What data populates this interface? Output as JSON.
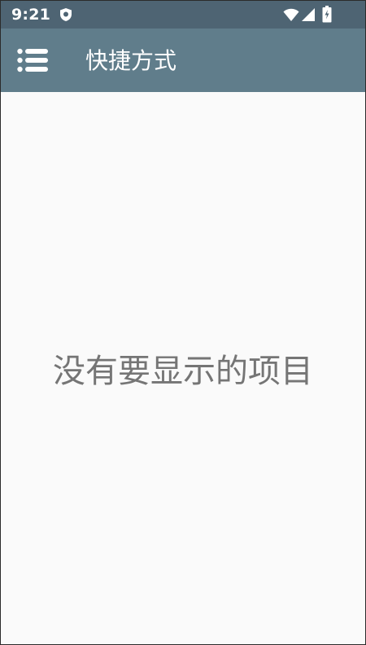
{
  "status_bar": {
    "time": "9:21",
    "icons": [
      "shield-icon",
      "wifi-icon",
      "signal-icon",
      "battery-icon"
    ]
  },
  "app_bar": {
    "title": "快捷方式",
    "menu_icon": "menu-icon",
    "background_color": "#607d8b"
  },
  "content": {
    "empty_message": "没有要显示的项目"
  },
  "colors": {
    "status_bar": "#4e6473",
    "app_bar": "#607d8b",
    "background": "#fafafa",
    "empty_text": "#757575"
  }
}
